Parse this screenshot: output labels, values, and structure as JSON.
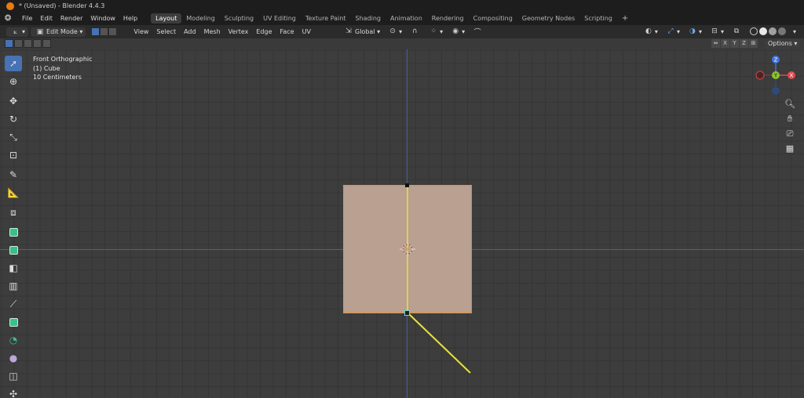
{
  "window": {
    "title": "* (Unsaved) - Blender 4.4.3"
  },
  "menu": {
    "items": [
      "File",
      "Edit",
      "Render",
      "Window",
      "Help"
    ],
    "workspaces": [
      "Layout",
      "Modeling",
      "Sculpting",
      "UV Editing",
      "Texture Paint",
      "Shading",
      "Animation",
      "Rendering",
      "Compositing",
      "Geometry Nodes",
      "Scripting"
    ],
    "active_workspace": "Layout",
    "add_workspace": "+"
  },
  "header": {
    "mode": "Edit Mode",
    "menus": [
      "View",
      "Select",
      "Add",
      "Mesh",
      "Vertex",
      "Edge",
      "Face",
      "UV"
    ],
    "orientation": "Global"
  },
  "subheader": {
    "axis_locks": [
      "X",
      "Y",
      "Z"
    ],
    "options_label": "Options"
  },
  "viewport": {
    "info": [
      "Front Orthographic",
      "(1) Cube",
      "10 Centimeters"
    ],
    "gizmo": {
      "z": "Z",
      "y": "Y",
      "x": "X"
    }
  },
  "colors": {
    "accent": "#4772b3",
    "face_fill": "#b9a090",
    "edge_select": "#f08a24",
    "x_axis": "#a8423b",
    "z_axis": "#3e5fb0",
    "edge_highlight": "#e8e23a"
  }
}
